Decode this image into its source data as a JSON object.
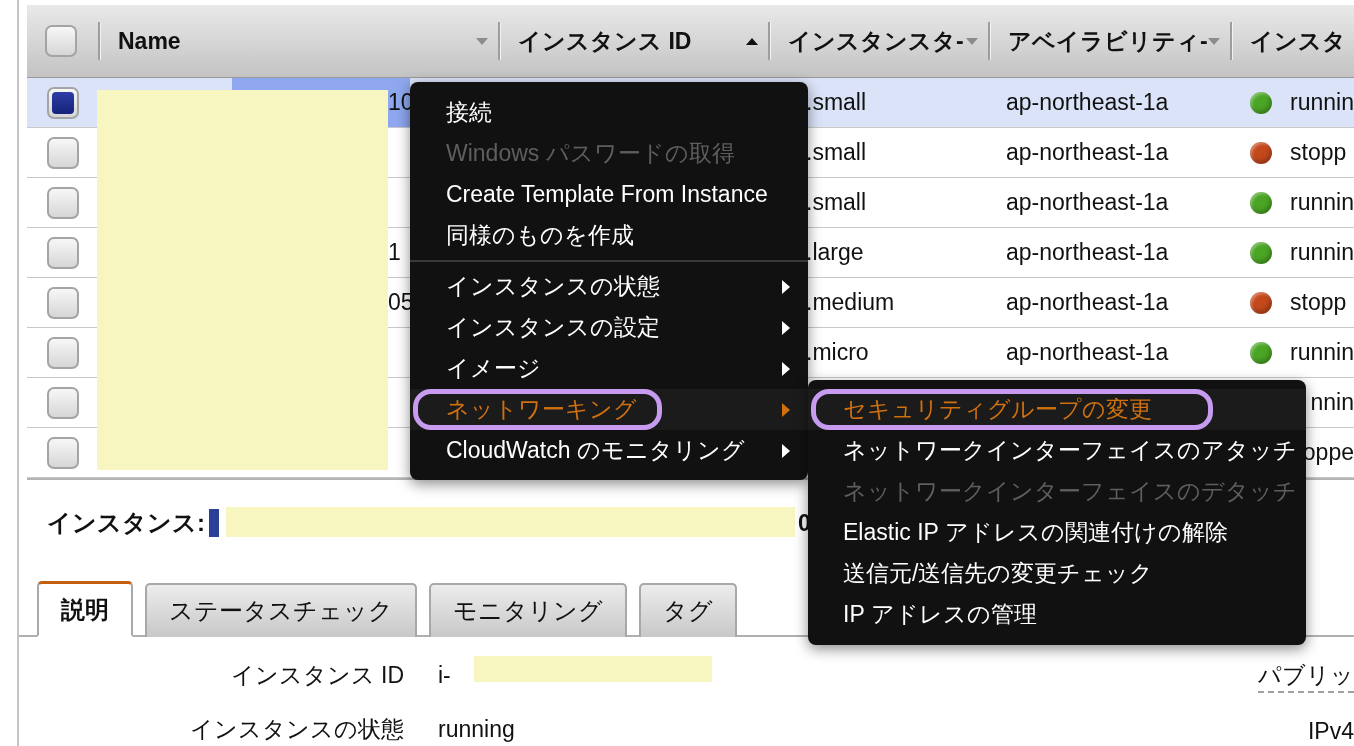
{
  "table": {
    "select_all": {
      "checked": false
    },
    "columns": [
      {
        "label": "Name",
        "sorted": false
      },
      {
        "label": "インスタンス ID",
        "sorted": true
      },
      {
        "label": "インスタンスタ-",
        "sorted": false
      },
      {
        "label": "アベイラビリティ-",
        "sorted": false
      },
      {
        "label": "インスタ"
      }
    ],
    "rows": [
      {
        "selected": true,
        "checked": true,
        "name": "10",
        "type": ".small",
        "zone": "ap-northeast-1a",
        "state": {
          "label": "runnin",
          "color": "#4aa524"
        }
      },
      {
        "selected": false,
        "checked": false,
        "type": ".small",
        "zone": "ap-northeast-1a",
        "state": {
          "label": "stopp",
          "color": "#c4481c"
        }
      },
      {
        "selected": false,
        "checked": false,
        "type": ".small",
        "zone": "ap-northeast-1a",
        "state": {
          "label": "runnin",
          "color": "#4aa524"
        }
      },
      {
        "selected": false,
        "checked": false,
        "name": "1",
        "type": ".large",
        "zone": "ap-northeast-1a",
        "state": {
          "label": "runnin",
          "color": "#4aa524"
        }
      },
      {
        "selected": false,
        "checked": false,
        "name": "05",
        "type": ".medium",
        "zone": "ap-northeast-1a",
        "state": {
          "label": "stopp",
          "color": "#c4481c"
        }
      },
      {
        "selected": false,
        "checked": false,
        "type": ".micro",
        "zone": "ap-northeast-1a",
        "state": {
          "label": "runnin",
          "color": "#4aa524"
        }
      },
      {
        "selected": false,
        "checked": false,
        "state": {
          "label": "nnin"
        }
      },
      {
        "selected": false,
        "checked": false,
        "state": {
          "label": "oppe"
        }
      }
    ]
  },
  "context_menu": {
    "items": [
      {
        "kind": "item",
        "label": "接続",
        "disabled": false
      },
      {
        "kind": "item",
        "label": "Windows パスワードの取得",
        "disabled": true
      },
      {
        "kind": "item",
        "label": "Create Template From Instance",
        "disabled": false
      },
      {
        "kind": "item",
        "label": "同様のものを作成",
        "disabled": false
      },
      {
        "kind": "divider"
      },
      {
        "kind": "submenu",
        "label": "インスタンスの状態",
        "highlighted": false,
        "annotated": false
      },
      {
        "kind": "submenu",
        "label": "インスタンスの設定",
        "highlighted": false,
        "annotated": false
      },
      {
        "kind": "submenu",
        "label": "イメージ",
        "highlighted": false,
        "annotated": false
      },
      {
        "kind": "submenu",
        "label": "ネットワーキング",
        "highlighted": true,
        "annotated": true
      },
      {
        "kind": "submenu",
        "label": "CloudWatch のモニタリング",
        "highlighted": false,
        "annotated": false
      }
    ]
  },
  "submenu": {
    "items": [
      {
        "label": "セキュリティグループの変更",
        "highlighted": true,
        "annotated": true,
        "disabled": false
      },
      {
        "label": "ネットワークインターフェイスのアタッチ",
        "highlighted": false,
        "annotated": false,
        "disabled": false
      },
      {
        "label": "ネットワークインターフェイスのデタッチ",
        "highlighted": false,
        "annotated": false,
        "disabled": true
      },
      {
        "label": "Elastic IP アドレスの関連付けの解除",
        "highlighted": false,
        "annotated": false,
        "disabled": false
      },
      {
        "label": "送信元/送信先の変更チェック",
        "highlighted": false,
        "annotated": false,
        "disabled": false
      },
      {
        "label": "IP アドレスの管理",
        "highlighted": false,
        "annotated": false,
        "disabled": false
      }
    ]
  },
  "instance_header": {
    "label": "インスタンス:",
    "id_tail": "0"
  },
  "tabs": [
    {
      "label": "説明",
      "selected": true
    },
    {
      "label": "ステータスチェック",
      "selected": false
    },
    {
      "label": "モニタリング",
      "selected": false
    },
    {
      "label": "タグ",
      "selected": false
    }
  ],
  "details": [
    {
      "label": "インスタンス ID",
      "value": "i-"
    },
    {
      "label": "インスタンスの状態",
      "value": "running"
    }
  ],
  "details_right": [
    {
      "label": "パブリッ"
    },
    {
      "label": "IPv4"
    }
  ]
}
